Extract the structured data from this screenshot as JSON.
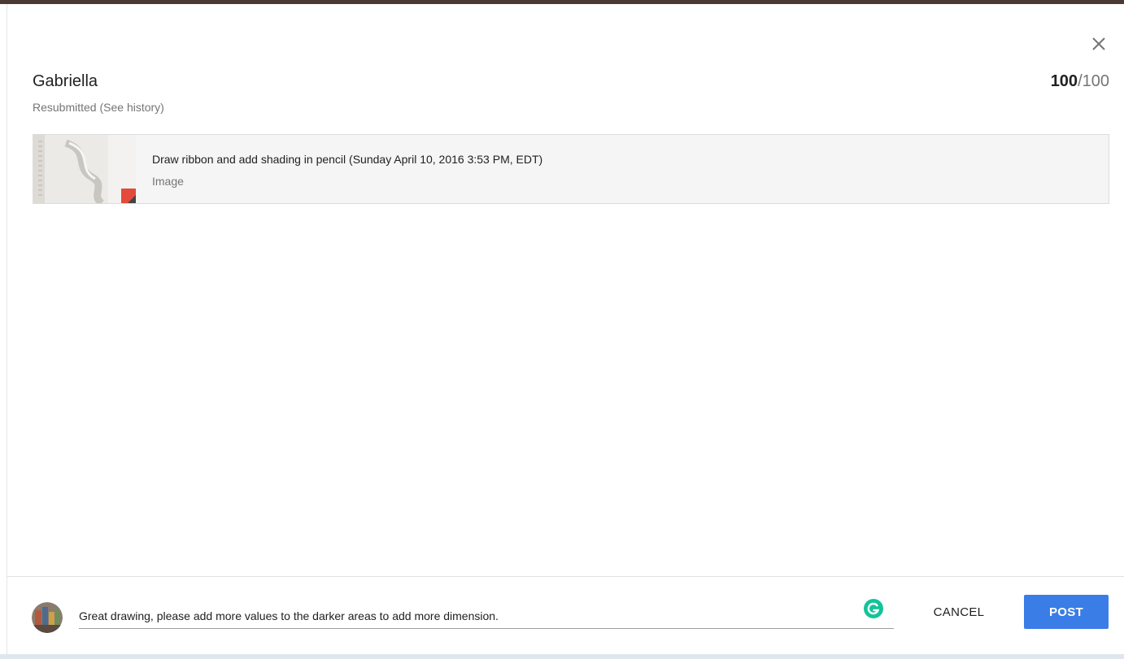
{
  "dialog": {
    "student_name": "Gabriella",
    "status": "Resubmitted (See history)",
    "grade": {
      "value": "100",
      "separator": "/",
      "max": "100"
    },
    "close_icon": "close-icon"
  },
  "attachment": {
    "title": "Draw ribbon and add shading in pencil (Sunday April 10, 2016 3:53 PM, EDT)",
    "type": "Image"
  },
  "comment": {
    "value": "Great drawing, please add more values to the darker areas to add more dimension.",
    "grammarly_icon": "grammarly-icon"
  },
  "actions": {
    "cancel_label": "CANCEL",
    "post_label": "POST"
  },
  "colors": {
    "accent": "#3b7de6",
    "grammarly": "#15c39a"
  }
}
